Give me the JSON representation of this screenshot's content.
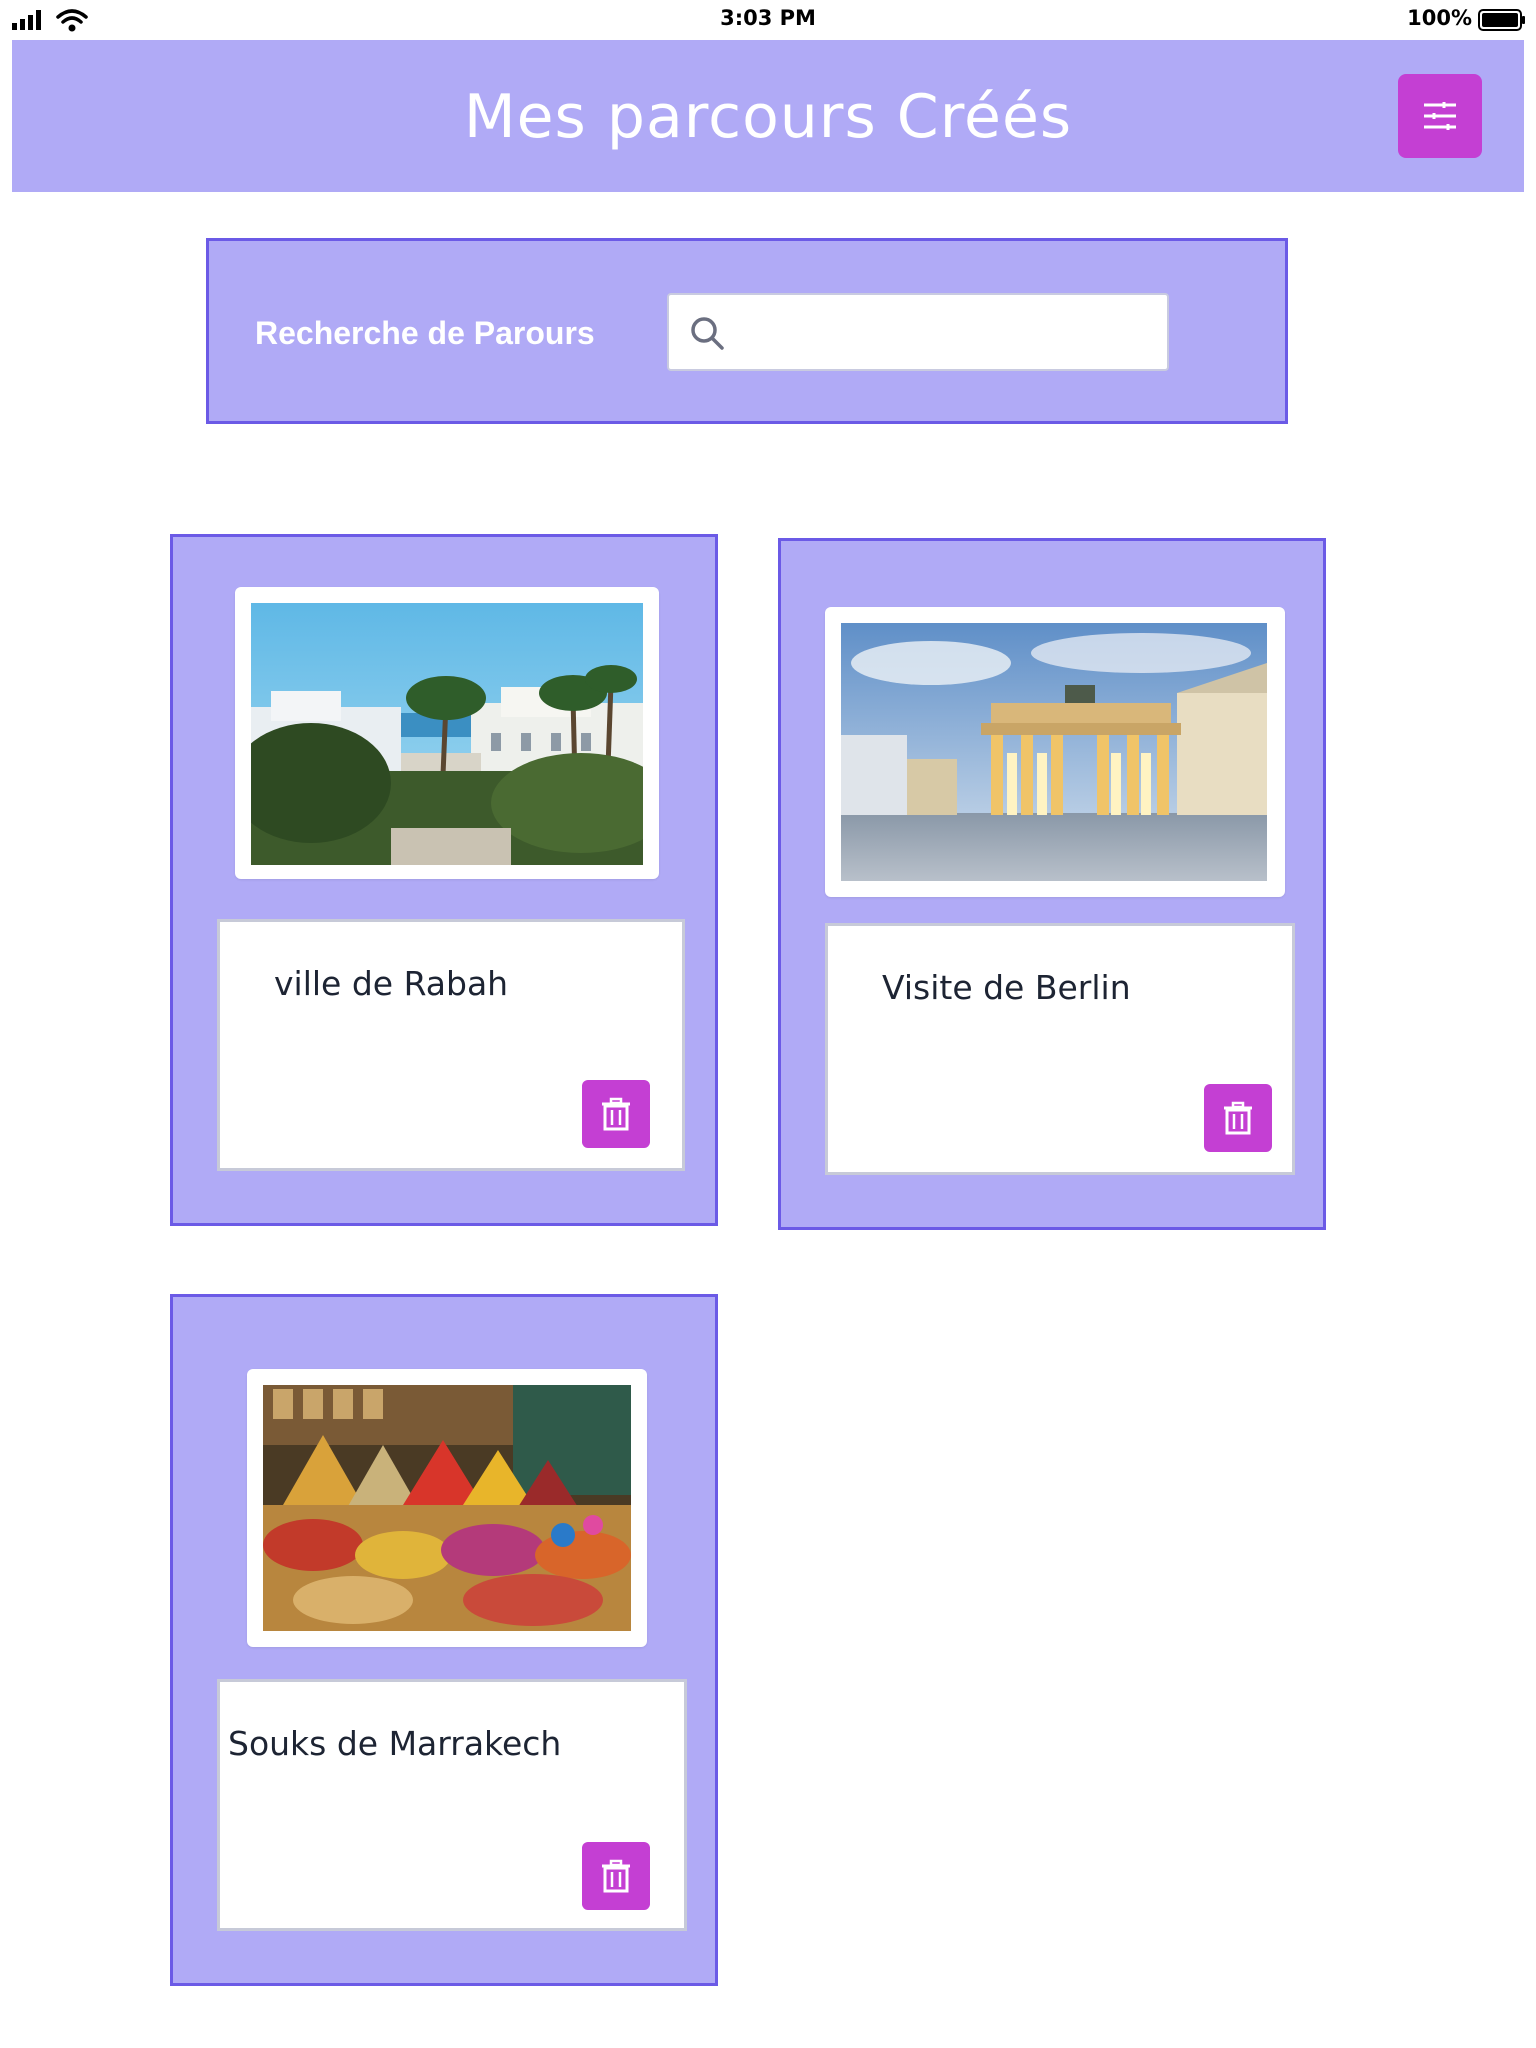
{
  "status_bar": {
    "time": "3:03 PM",
    "battery": "100%",
    "icons": [
      "signal-icon",
      "wifi-icon",
      "battery-icon"
    ]
  },
  "header": {
    "title": "Mes parcours Créés",
    "menu_icon": "filter-lines-icon"
  },
  "search": {
    "label": "Recherche de Parours",
    "value": "",
    "icon": "search-icon"
  },
  "cards": [
    {
      "title": "ville de Rabah",
      "image": "coastal-city-palms-photo",
      "delete_icon": "trash-icon"
    },
    {
      "title": "Visite de Berlin",
      "image": "brandenburg-gate-photo",
      "delete_icon": "trash-icon"
    },
    {
      "title": "Souks de Marrakech",
      "image": "spice-market-photo",
      "delete_icon": "trash-icon"
    }
  ],
  "colors": {
    "header_bg": "#b0aaf6",
    "panel_border": "#6b5ae6",
    "accent_button": "#c43fd3",
    "text_dark": "#1d2433"
  }
}
